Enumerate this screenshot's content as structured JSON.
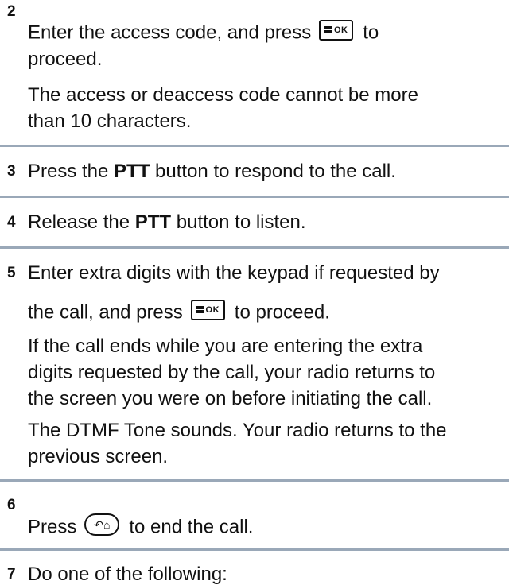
{
  "steps": [
    {
      "number": "2",
      "line1_pre": "Enter the access code, and press",
      "line1_post": "to",
      "line2": "proceed.",
      "note_line1": "The access or deaccess code cannot be more",
      "note_line2": "than 10 characters."
    },
    {
      "number": "3",
      "pre": "Press the ",
      "bold": "PTT",
      "post": " button to respond to the call."
    },
    {
      "number": "4",
      "pre": "Release the ",
      "bold": "PTT",
      "post": " button to listen."
    },
    {
      "number": "5",
      "line1": "Enter extra digits with the keypad if requested by",
      "line2_pre": "the call, and press",
      "line2_post": "to proceed.",
      "note1_line1": "If the call ends while you are entering the extra",
      "note1_line2": "digits requested by the call, your radio returns to",
      "note1_line3": "the screen you were on before initiating the call.",
      "note2_line1": "The DTMF Tone sounds. Your radio returns to the",
      "note2_line2": "previous screen."
    },
    {
      "number": "6",
      "pre": "Press",
      "post": "to end the call."
    },
    {
      "number": "7",
      "text": "Do one of the following:"
    }
  ],
  "keys": {
    "ok_key": {
      "label": "OK",
      "icon": "menu-grid-icon"
    },
    "back_home_key": {
      "glyphs": "↶⌂",
      "icon": "back-home-icon"
    }
  },
  "colors": {
    "divider": "#9aa8b8",
    "text": "#111111"
  }
}
